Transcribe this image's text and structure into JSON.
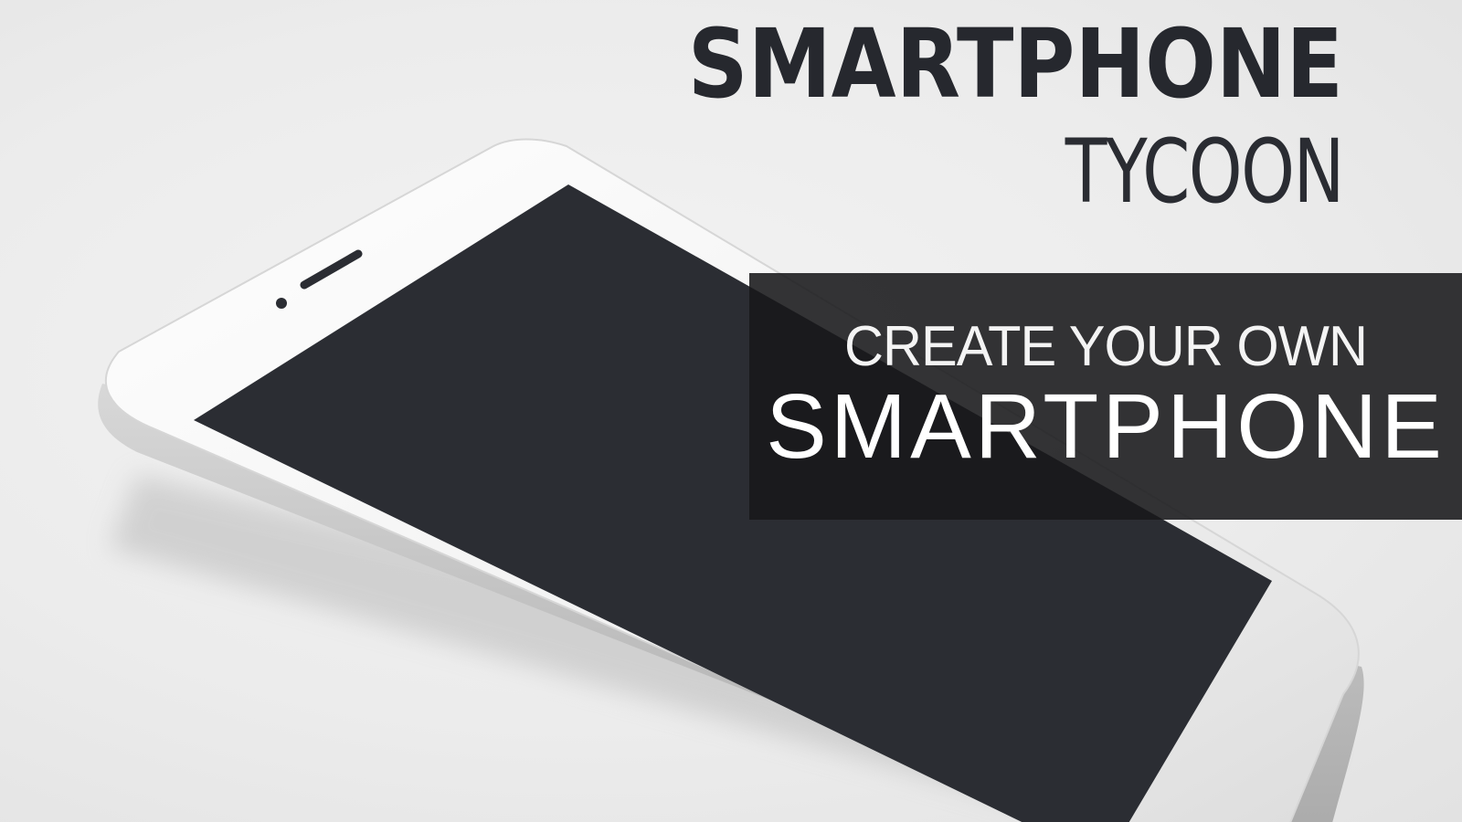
{
  "title": {
    "main": "SMARTPHONE",
    "sub": "TYCOON"
  },
  "tagline": {
    "line1": "CREATE YOUR OWN",
    "line2": "SMARTPHONE"
  },
  "colors": {
    "background": "#ececec",
    "title_text": "#26282e",
    "banner": "#18181a",
    "banner_text": "#ffffff",
    "phone_body": "#f4f4f4",
    "phone_screen": "#2b2d33"
  }
}
